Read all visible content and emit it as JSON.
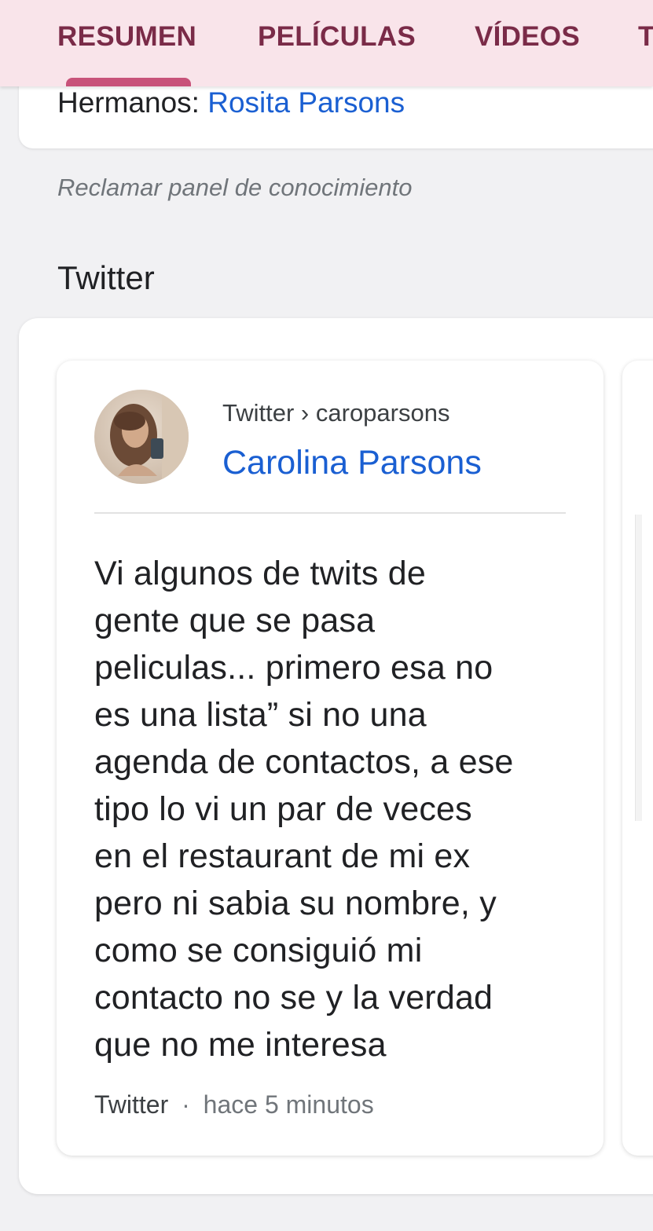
{
  "tabs": [
    {
      "label": "RESUMEN",
      "active": true
    },
    {
      "label": "PELÍCULAS",
      "active": false
    },
    {
      "label": "VÍDEOS",
      "active": false
    },
    {
      "label": "T",
      "active": false
    }
  ],
  "knowledge_panel": {
    "siblings_label": "Hermanos:",
    "siblings_value": "Rosita Parsons",
    "claim_link": "Reclamar panel de conocimiento"
  },
  "twitter": {
    "heading": "Twitter",
    "tweet": {
      "source": "Twitter",
      "separator": "›",
      "handle": "caroparsons",
      "name": "Carolina Parsons",
      "text_lines": [
        "Vi algunos de twits de",
        "gente que se pasa",
        "peliculas... primero esa no",
        "es una lista” si no una",
        "agenda de contactos, a ese",
        "tipo lo vi un par de veces",
        "en el restaurant de mi ex",
        "pero ni sabia su nombre, y",
        "como se consiguió mi",
        "contacto no se y la verdad",
        "que no me interesa"
      ],
      "footer_source": "Twitter",
      "footer_dot": "·",
      "time": "hace 5 minutos"
    }
  },
  "colors": {
    "tab_bar_bg": "#f9e4ea",
    "tab_text": "#7a2b48",
    "tab_indicator": "#c8537a",
    "link_blue": "#1a5fd2"
  }
}
